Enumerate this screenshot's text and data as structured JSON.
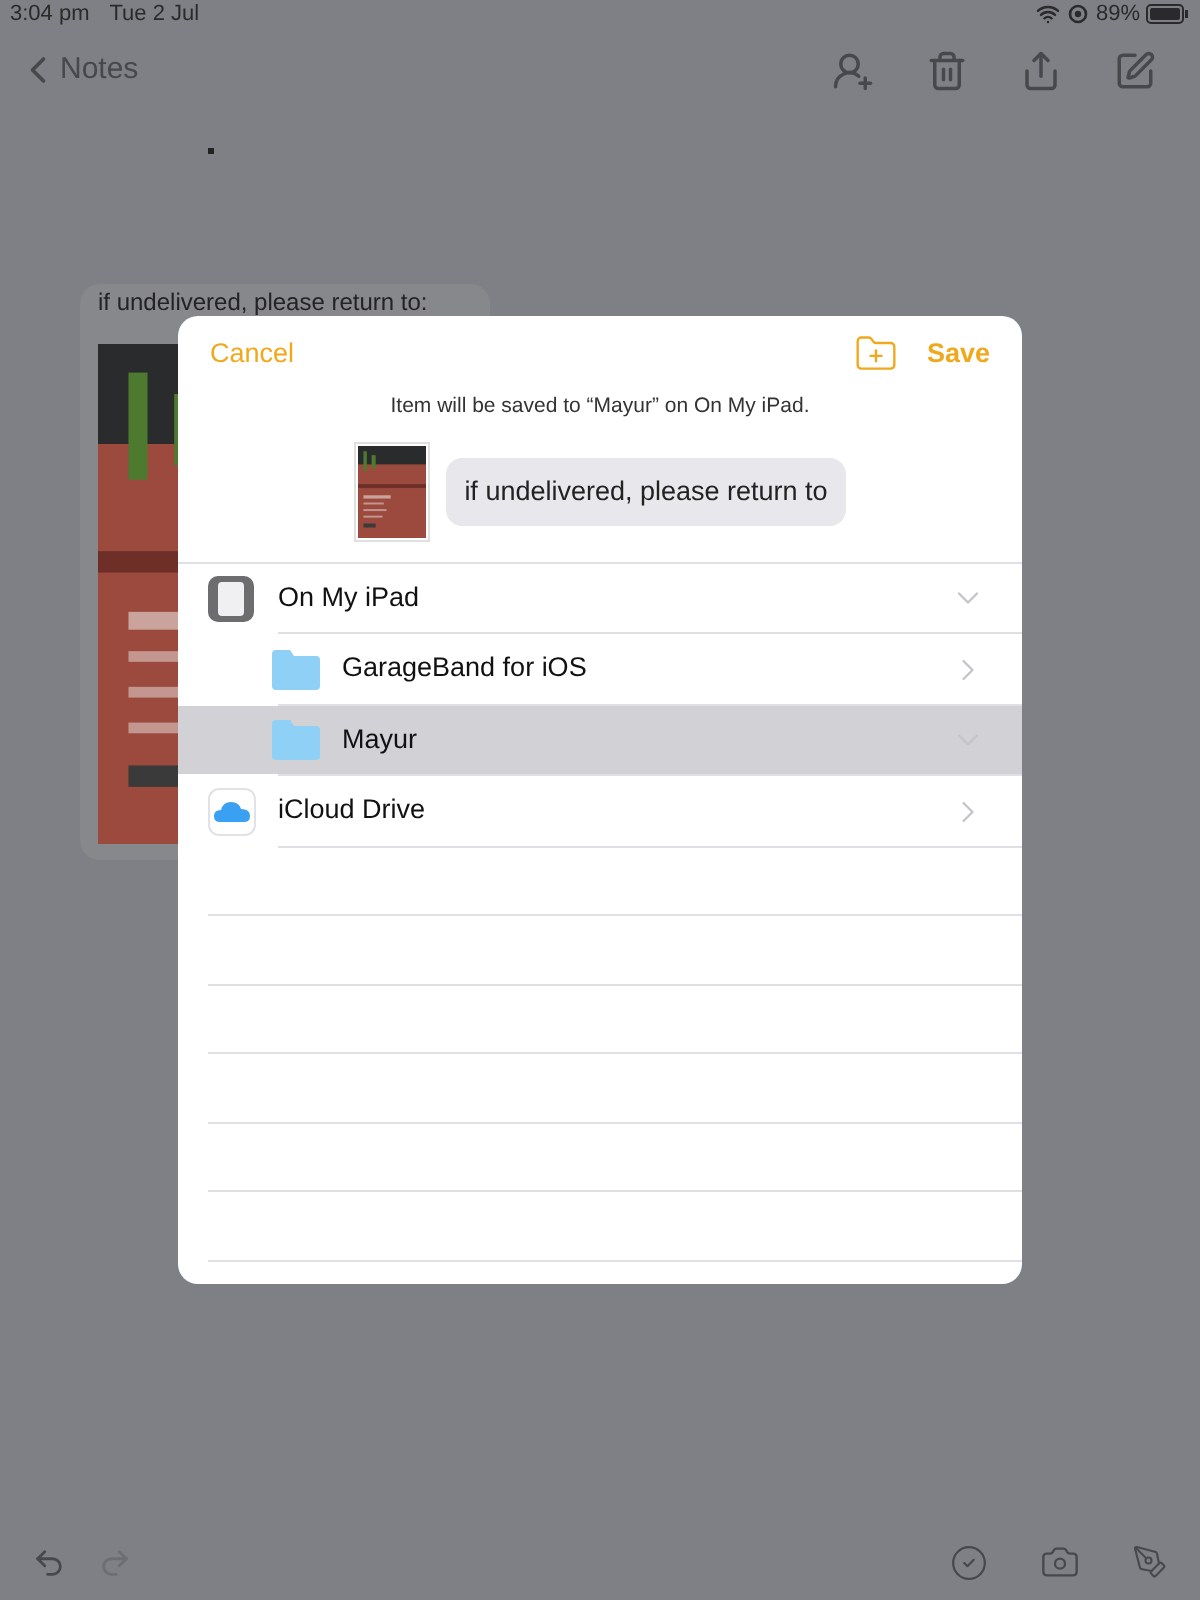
{
  "status_bar": {
    "time": "3:04 pm",
    "date": "Tue 2 Jul",
    "battery": "89%"
  },
  "nav": {
    "back": "Notes"
  },
  "note": {
    "title": "if undelivered, please return to:"
  },
  "dialog": {
    "cancel": "Cancel",
    "save": "Save",
    "message": "Item will be saved to “Mayur” on On My iPad.",
    "preview_text": "if undelivered, please return to",
    "locations": [
      {
        "kind": "device",
        "label": "On My iPad",
        "expanded": true,
        "selected": false,
        "children": [
          {
            "kind": "folder",
            "label": "GarageBand for iOS",
            "expanded": false,
            "selected": false
          },
          {
            "kind": "folder",
            "label": "Mayur",
            "expanded": true,
            "selected": true
          }
        ]
      },
      {
        "kind": "cloud",
        "label": "iCloud Drive",
        "expanded": false,
        "selected": false
      }
    ]
  }
}
